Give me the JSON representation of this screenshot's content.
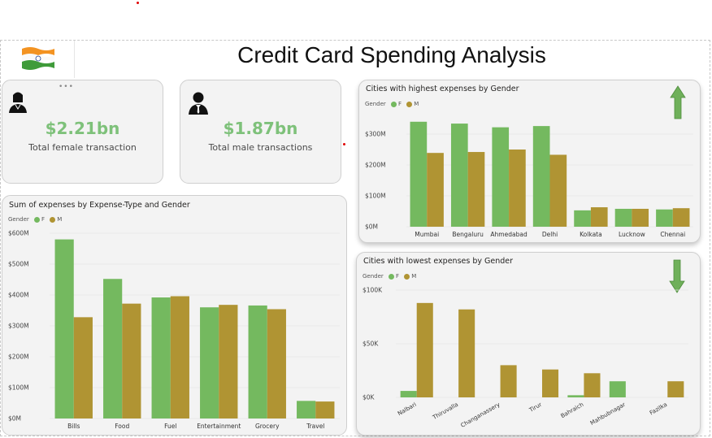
{
  "header": {
    "title": "Credit Card Spending Analysis",
    "flag": "india-flag"
  },
  "kpis": {
    "female": {
      "value": "$2.21bn",
      "label": "Total female transaction",
      "icon": "female-user-icon"
    },
    "male": {
      "value": "$1.87bn",
      "label": "Total male transactions",
      "icon": "male-user-icon"
    }
  },
  "colors": {
    "F": "#74b95f",
    "M": "#b09433",
    "up_arrow": "#6fb05a",
    "down_arrow": "#6fb05a",
    "kpi_value": "#7ec17a"
  },
  "legend": {
    "label": "Gender",
    "f": "F",
    "m": "M"
  },
  "charts": {
    "expense_type": {
      "title": "Sum of expenses by Expense-Type and Gender"
    },
    "highest": {
      "title": "Cities with highest expenses by Gender",
      "arrow": "up-arrow-icon"
    },
    "lowest": {
      "title": "Cities with lowest expenses by Gender",
      "arrow": "down-arrow-icon"
    }
  },
  "chart_data": [
    {
      "id": "expense_type",
      "type": "bar",
      "title": "Sum of expenses by Expense-Type and Gender",
      "categories": [
        "Bills",
        "Food",
        "Fuel",
        "Entertainment",
        "Grocery",
        "Travel"
      ],
      "series": [
        {
          "name": "F",
          "values": [
            580,
            452,
            392,
            360,
            366,
            57
          ]
        },
        {
          "name": "M",
          "values": [
            328,
            372,
            396,
            368,
            354,
            55
          ]
        }
      ],
      "yticks": [
        "$0M",
        "$100M",
        "$200M",
        "$300M",
        "$400M",
        "$500M",
        "$600M"
      ],
      "ylim": [
        0,
        600
      ],
      "legend": "top-left",
      "grid": true
    },
    {
      "id": "highest",
      "type": "bar",
      "title": "Cities with highest expenses by Gender",
      "categories": [
        "Mumbai",
        "Bengaluru",
        "Ahmedabad",
        "Delhi",
        "Kolkata",
        "Lucknow",
        "Chennai"
      ],
      "series": [
        {
          "name": "F",
          "values": [
            340,
            334,
            322,
            326,
            53,
            58,
            56
          ]
        },
        {
          "name": "M",
          "values": [
            239,
            242,
            250,
            233,
            63,
            58,
            60
          ]
        }
      ],
      "yticks": [
        "$0M",
        "$100M",
        "$200M",
        "$300M"
      ],
      "ylim": [
        0,
        300
      ],
      "legend": "top-left",
      "grid": true
    },
    {
      "id": "lowest",
      "type": "bar",
      "title": "Cities with lowest expenses by Gender",
      "categories": [
        "Nalbari",
        "Thiruvalla",
        "Changanassery",
        "Tirur",
        "Bahraich",
        "Mahbubnagar",
        "Fazilka"
      ],
      "series": [
        {
          "name": "F",
          "values": [
            6000,
            0,
            0,
            0,
            2000,
            15000,
            0
          ]
        },
        {
          "name": "M",
          "values": [
            88000,
            82000,
            30000,
            26000,
            22500,
            0,
            15000
          ]
        }
      ],
      "yticks": [
        "$0K",
        "$50K",
        "$100K"
      ],
      "ylim": [
        0,
        100000
      ],
      "legend": "top-left",
      "grid": true
    }
  ]
}
